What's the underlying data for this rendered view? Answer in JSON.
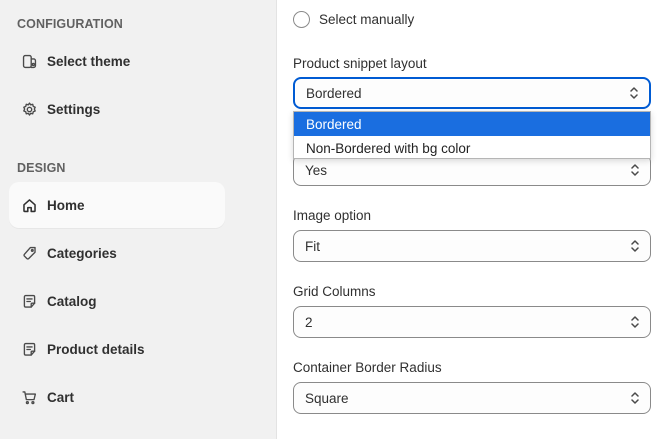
{
  "sidebar": {
    "configuration_title": "CONFIGURATION",
    "design_title": "DESIGN",
    "config_items": [
      {
        "label": "Select theme",
        "icon": "theme-icon"
      },
      {
        "label": "Settings",
        "icon": "gear-icon"
      }
    ],
    "design_items": [
      {
        "label": "Home",
        "icon": "home-icon",
        "active": true
      },
      {
        "label": "Categories",
        "icon": "tag-icon"
      },
      {
        "label": "Catalog",
        "icon": "catalog-icon"
      },
      {
        "label": "Product details",
        "icon": "product-details-icon"
      },
      {
        "label": "Cart",
        "icon": "cart-icon"
      }
    ]
  },
  "main": {
    "radio_label": "Select manually",
    "fields": [
      {
        "label": "Product snippet layout",
        "value": "Bordered",
        "options": [
          "Bordered",
          "Non-Bordered with bg color"
        ]
      },
      {
        "label": "",
        "value": "Yes"
      },
      {
        "label": "Image option",
        "value": "Fit"
      },
      {
        "label": "Grid Columns",
        "value": "2"
      },
      {
        "label": "Container Border Radius",
        "value": "Square"
      }
    ]
  },
  "colors": {
    "accent": "#005bd3",
    "selected_option": "#1a6ee0",
    "sidebar_bg": "#f1f1f1"
  }
}
